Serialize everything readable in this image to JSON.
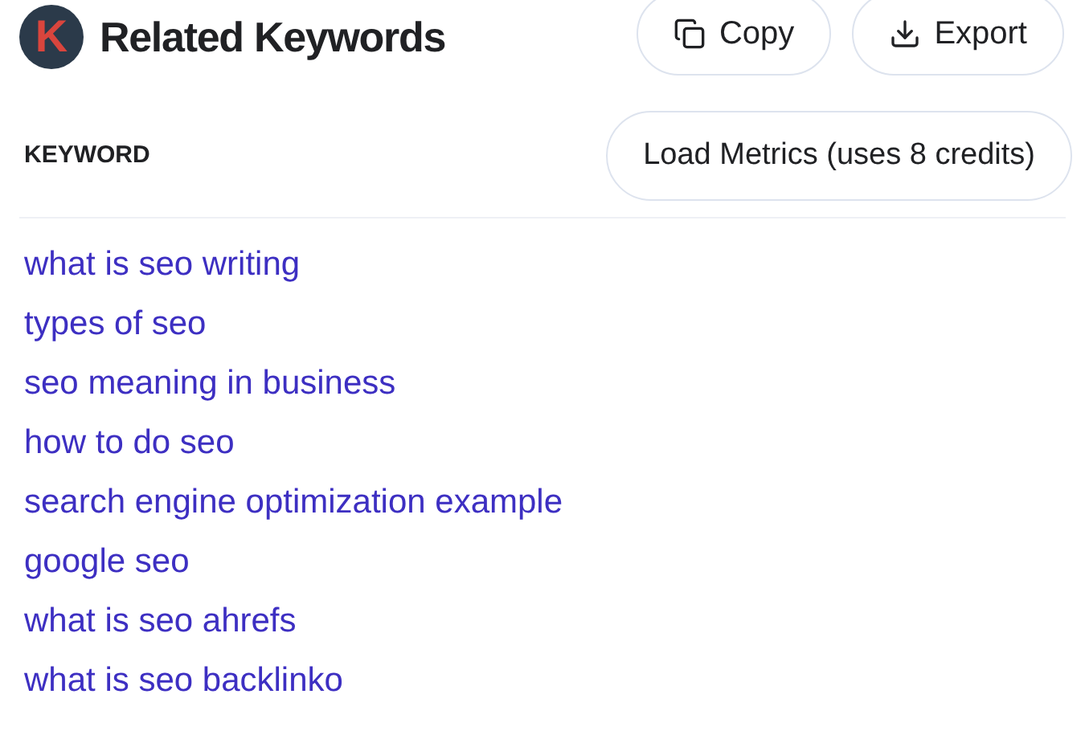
{
  "header": {
    "logo": "K",
    "title": "Related Keywords",
    "buttons": [
      {
        "kind": "copy",
        "label": "Copy"
      },
      {
        "kind": "export",
        "label": "Export"
      }
    ]
  },
  "table": {
    "column_header": "KEYWORD",
    "action": "Load Metrics (uses 8 credits)"
  },
  "keywords": [
    "what is seo writing",
    "types of seo",
    "seo meaning in business",
    "how to do seo",
    "search engine optimization example",
    "google seo",
    "what is seo ahrefs",
    "what is seo backlinko"
  ]
}
